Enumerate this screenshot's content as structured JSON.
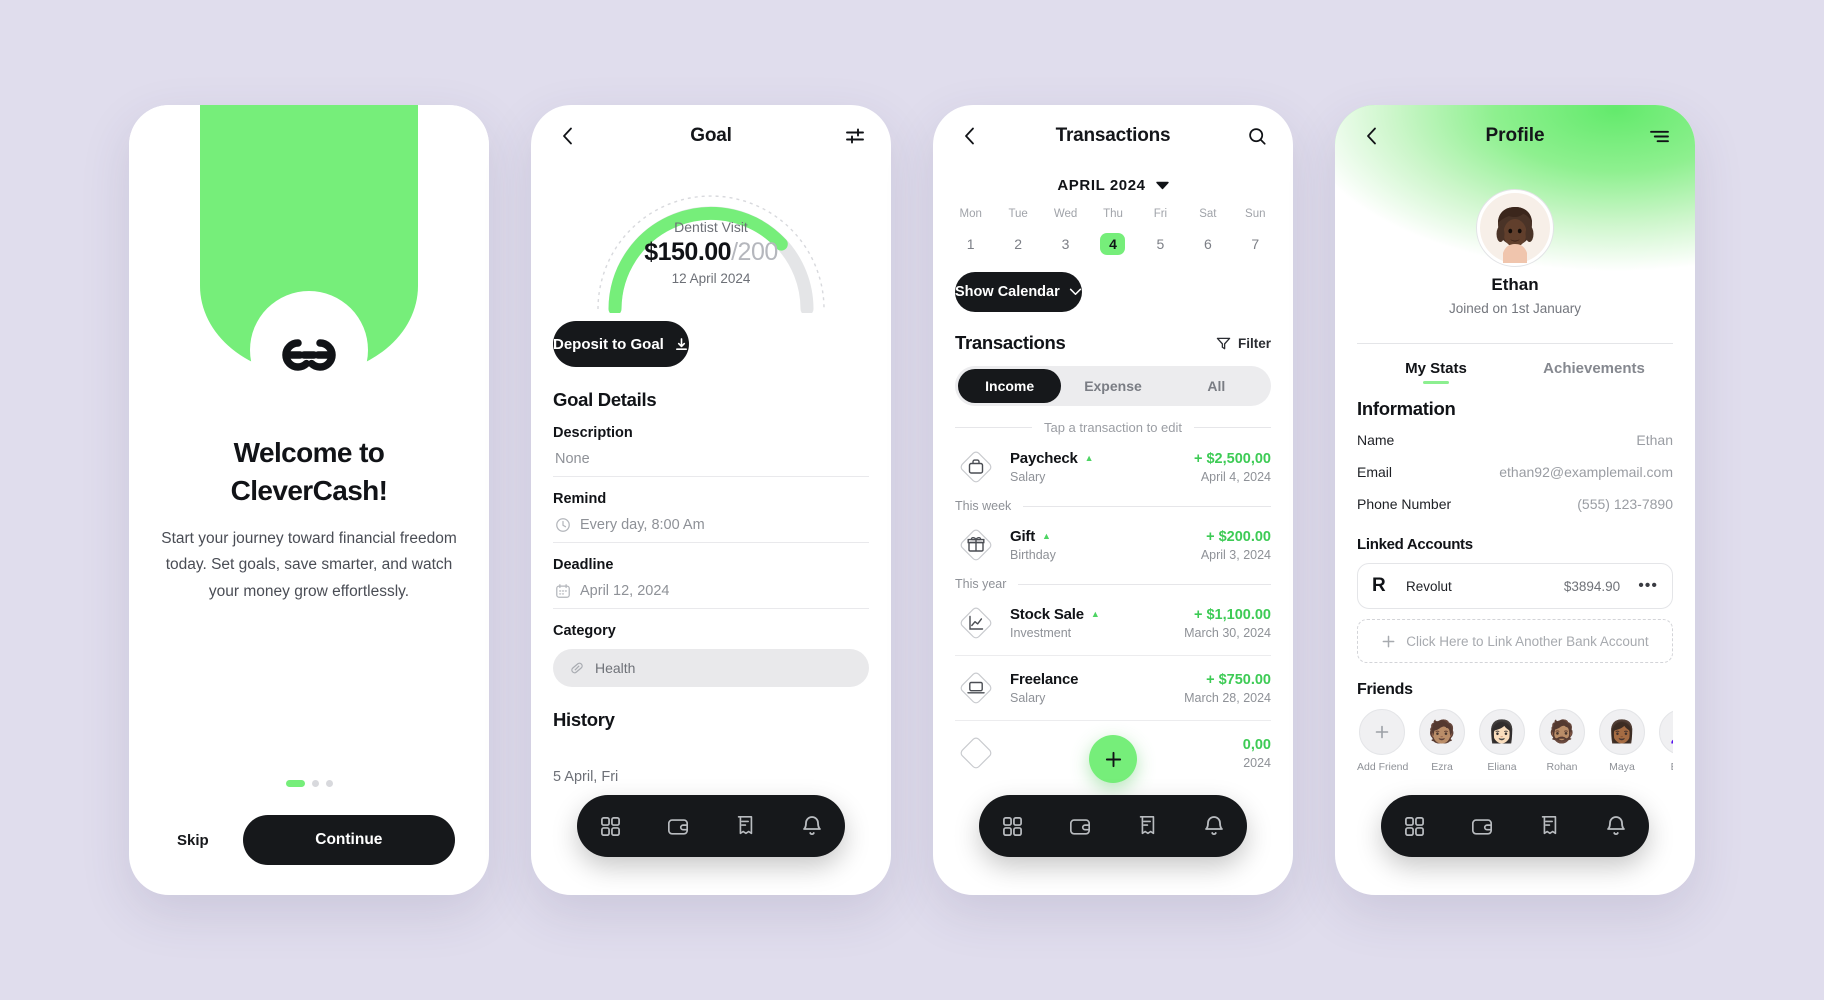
{
  "theme": {
    "background": "#e0dded",
    "accent_green": "#76ee7a",
    "dark": "#16181b",
    "income_green": "#3dcb55"
  },
  "screen_onboarding": {
    "logo_icon": "clevercash-logo-icon",
    "title": "Welcome to\nCleverCash!",
    "title_line1": "Welcome to",
    "title_line2": "CleverCash!",
    "subtitle": "Start your journey toward financial freedom today. Set goals, save smarter, and watch your money grow effortlessly.",
    "dots": {
      "count": 3,
      "active_index": 0
    },
    "skip_label": "Skip",
    "continue_label": "Continue"
  },
  "screen_goal": {
    "header": {
      "title": "Goal",
      "back_icon": "chevron-left-icon",
      "settings_icon": "sliders-icon"
    },
    "gauge": {
      "name": "Dentist Visit",
      "amount": "$150.00",
      "separator": "/",
      "target": "200",
      "date": "12 April 2024",
      "progress_percent": 75
    },
    "deposit_label": "Deposit to Goal",
    "deposit_icon": "download-icon",
    "details_heading": "Goal Details",
    "fields": [
      {
        "label": "Description",
        "value": "None",
        "icon": null
      },
      {
        "label": "Remind",
        "value": "Every day, 8:00 Am",
        "icon": "clock-icon"
      },
      {
        "label": "Deadline",
        "value": "April 12, 2024",
        "icon": "calendar-icon"
      }
    ],
    "category_label": "Category",
    "category_value": "Health",
    "category_icon": "pill-icon",
    "history_heading": "History",
    "history_first_entry": "5 April, Fri"
  },
  "screen_transactions": {
    "header": {
      "title": "Transactions",
      "back_icon": "chevron-left-icon",
      "search_icon": "search-icon"
    },
    "month_label": "APRIL 2024",
    "month_caret_icon": "caret-down-icon",
    "weekday_headers": [
      "Mon",
      "Tue",
      "Wed",
      "Thu",
      "Fri",
      "Sat",
      "Sun"
    ],
    "week_days": [
      "1",
      "2",
      "3",
      "4",
      "5",
      "6",
      "7"
    ],
    "selected_day": "4",
    "show_calendar_label": "Show Calendar",
    "show_calendar_icon": "chevron-down-icon",
    "section_title": "Transactions",
    "filter_label": "Filter",
    "filter_icon": "funnel-icon",
    "segments": [
      {
        "label": "Income",
        "active": true
      },
      {
        "label": "Expense",
        "active": false
      },
      {
        "label": "All",
        "active": false
      }
    ],
    "hint": "Tap a transaction to edit",
    "items": [
      {
        "icon": "briefcase-icon",
        "name": "Paycheck",
        "category": "Salary",
        "amount": "+ $2,500,00",
        "date": "April 4, 2024",
        "trend": "up",
        "group_after": "This week"
      },
      {
        "icon": "gift-icon",
        "name": "Gift",
        "category": "Birthday",
        "amount": "+ $200.00",
        "date": "April 3, 2024",
        "trend": "up",
        "group_after": "This year"
      },
      {
        "icon": "chart-line-icon",
        "name": "Stock Sale",
        "category": "Investment",
        "amount": "+ $1,100.00",
        "date": "March 30, 2024",
        "trend": "up",
        "group_after": null
      },
      {
        "icon": "laptop-icon",
        "name": "Freelance",
        "category": "Salary",
        "amount": "+ $750.00",
        "date": "March 28, 2024",
        "trend": "up",
        "group_after": null
      },
      {
        "icon": "diamond-icon",
        "name": "",
        "category": "",
        "amount": "0,00",
        "date": "2024",
        "trend": "up",
        "group_after": null
      }
    ],
    "fab_icon": "plus-icon"
  },
  "screen_profile": {
    "header": {
      "title": "Profile",
      "back_icon": "chevron-left-icon",
      "menu_icon": "hamburger-icon"
    },
    "avatar_icon": "user-avatar",
    "name": "Ethan",
    "joined": "Joined on 1st January",
    "tabs": [
      {
        "label": "My Stats",
        "active": true
      },
      {
        "label": "Achievements",
        "active": false
      }
    ],
    "information_heading": "Information",
    "information_rows": [
      {
        "key": "Name",
        "value": "Ethan"
      },
      {
        "key": "Email",
        "value": "ethan92@examplemail.com"
      },
      {
        "key": "Phone Number",
        "value": "(555) 123-7890"
      }
    ],
    "linked_accounts_heading": "Linked Accounts",
    "linked_account": {
      "logo": "R",
      "name": "Revolut",
      "balance": "$3894.90",
      "more_icon": "ellipsis-icon"
    },
    "link_another_label": "Click Here to Link Another Bank Account",
    "link_another_icon": "plus-icon",
    "friends_heading": "Friends",
    "friends": [
      {
        "name": "Add Friend",
        "is_add": true
      },
      {
        "name": "Ezra",
        "is_add": false
      },
      {
        "name": "Eliana",
        "is_add": false
      },
      {
        "name": "Rohan",
        "is_add": false
      },
      {
        "name": "Maya",
        "is_add": false
      },
      {
        "name": "Eliza",
        "is_add": false
      }
    ]
  },
  "bottom_nav": {
    "items": [
      {
        "icon": "grid-icon",
        "active": true
      },
      {
        "icon": "wallet-icon",
        "active": false
      },
      {
        "icon": "receipt-icon",
        "active": false
      },
      {
        "icon": "bell-icon",
        "active": false
      }
    ]
  }
}
